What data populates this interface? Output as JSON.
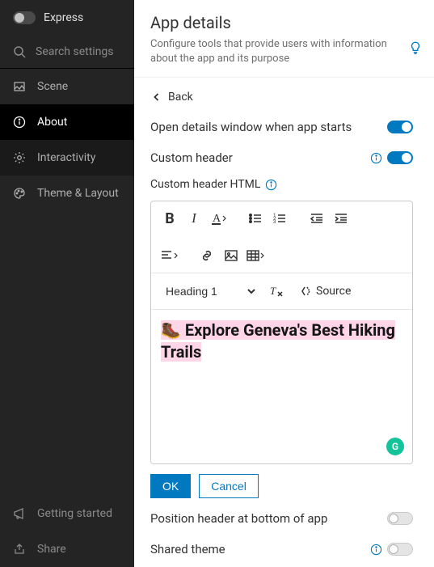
{
  "sidebar": {
    "express_label": "Express",
    "search_placeholder": "Search settings",
    "items": [
      {
        "label": "Scene"
      },
      {
        "label": "About"
      },
      {
        "label": "Interactivity"
      },
      {
        "label": "Theme & Layout"
      }
    ],
    "bottom": [
      {
        "label": "Getting started"
      },
      {
        "label": "Share"
      }
    ]
  },
  "header": {
    "title": "App details",
    "description": "Configure tools that provide users with information about the app and its purpose"
  },
  "back_label": "Back",
  "rows": {
    "open_details": "Open details window when app starts",
    "custom_header": "Custom header",
    "custom_header_html": "Custom header HTML",
    "position_bottom": "Position header at bottom of app",
    "shared_theme": "Shared theme"
  },
  "editor": {
    "format_selected": "Heading 1",
    "source_label": "Source",
    "content": "🥾 Explore Geneva's Best Hiking Trails"
  },
  "buttons": {
    "ok": "OK",
    "cancel": "Cancel"
  }
}
